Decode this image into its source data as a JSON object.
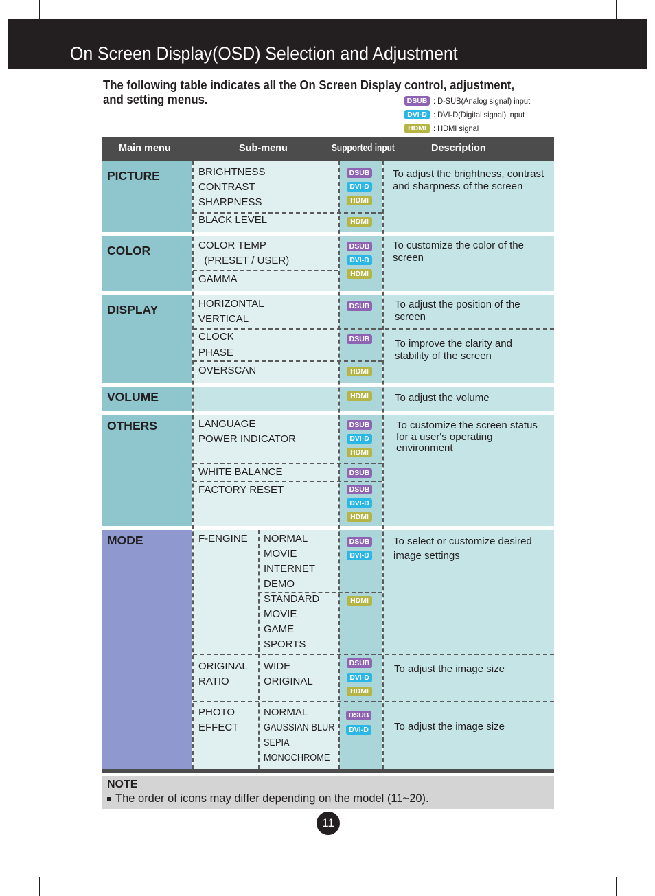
{
  "header": {
    "title": "On Screen Display(OSD) Selection and Adjustment"
  },
  "intro": {
    "text": "The following table indicates all the On Screen Display control, adjustment, and setting menus."
  },
  "legend": [
    {
      "badge": "DSUB",
      "text": ": D-SUB(Analog signal) input"
    },
    {
      "badge": "DVI-D",
      "text": ": DVI-D(Digital signal) input"
    },
    {
      "badge": "HDMI",
      "text": ": HDMI signal"
    }
  ],
  "badge_colors": {
    "DSUB": "#8e63b4",
    "DVI-D": "#2bb7e6",
    "HDMI": "#b4b545"
  },
  "table": {
    "headers": {
      "main": "Main menu",
      "sub": "Sub-menu",
      "input": "Supported input",
      "desc": "Description"
    },
    "picture": {
      "label": "PICTURE",
      "sub1": [
        "BRIGHTNESS",
        "CONTRAST",
        "SHARPNESS"
      ],
      "sub2": [
        "BLACK LEVEL"
      ],
      "inputs1": [
        "DSUB",
        "DVI-D",
        "HDMI"
      ],
      "inputs2": [
        "HDMI"
      ],
      "desc": "To adjust the brightness, contrast and sharpness of the screen"
    },
    "color": {
      "label": "COLOR",
      "sub1": [
        "COLOR TEMP",
        "  (PRESET / USER)"
      ],
      "sub2": [
        "GAMMA"
      ],
      "inputs": [
        "DSUB",
        "DVI-D",
        "HDMI"
      ],
      "desc": "To customize the color of the screen"
    },
    "display": {
      "label": "DISPLAY",
      "sub1": [
        "HORIZONTAL",
        "VERTICAL"
      ],
      "sub2": [
        "CLOCK",
        "PHASE"
      ],
      "sub3": [
        "OVERSCAN"
      ],
      "inputs1": [
        "DSUB"
      ],
      "inputs2": [
        "DSUB"
      ],
      "inputs3": [
        "HDMI"
      ],
      "desc1": "To adjust the position of the screen",
      "desc2": "To improve the clarity and stability of the screen"
    },
    "volume": {
      "label": "VOLUME",
      "inputs": [
        "HDMI"
      ],
      "desc": "To adjust the volume"
    },
    "others": {
      "label": "OTHERS",
      "sub1": [
        "LANGUAGE",
        "POWER INDICATOR"
      ],
      "sub2": [
        "WHITE BALANCE"
      ],
      "sub3": [
        "FACTORY RESET"
      ],
      "inputs1": [
        "DSUB",
        "DVI-D",
        "HDMI"
      ],
      "inputs2": [
        "DSUB"
      ],
      "inputs3": [
        "DSUB",
        "DVI-D",
        "HDMI"
      ],
      "desc": "To customize the screen status for a user's operating environment"
    },
    "mode": {
      "label": "MODE",
      "fengine": {
        "label": "F-ENGINE",
        "opts1": [
          "NORMAL",
          "MOVIE",
          "INTERNET",
          "DEMO"
        ],
        "opts2": [
          "STANDARD",
          "MOVIE",
          "GAME",
          "SPORTS"
        ],
        "inputs1": [
          "DSUB",
          "DVI-D"
        ],
        "inputs2": [
          "HDMI"
        ],
        "desc": "To select or customize desired image settings"
      },
      "ratio": {
        "label": [
          "ORIGINAL",
          "RATIO"
        ],
        "opts": [
          "WIDE",
          "ORIGINAL"
        ],
        "inputs": [
          "DSUB",
          "DVI-D",
          "HDMI"
        ],
        "desc": "To adjust the image size"
      },
      "photo": {
        "label": [
          "PHOTO",
          "EFFECT"
        ],
        "opts": [
          "NORMAL",
          "GAUSSIAN BLUR",
          "SEPIA",
          "MONOCHROME"
        ],
        "inputs": [
          "DSUB",
          "DVI-D"
        ],
        "desc": "To adjust the image size"
      }
    }
  },
  "note": {
    "title": "NOTE",
    "text": "The order of icons may differ depending on the model (11~20)."
  },
  "page_number": "11"
}
